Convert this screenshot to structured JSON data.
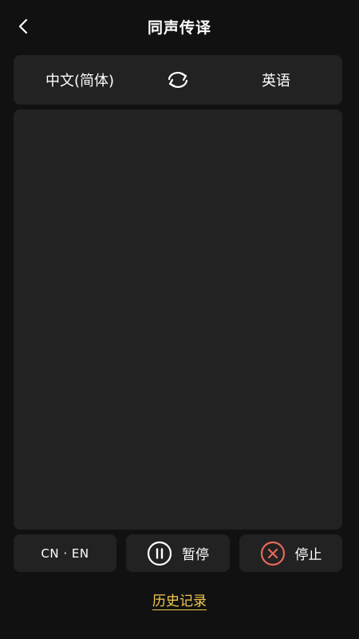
{
  "header": {
    "title": "同声传译"
  },
  "languages": {
    "source": "中文(简体)",
    "target": "英语"
  },
  "controls": {
    "lang_pair": "CN · EN",
    "pause_label": "暂停",
    "stop_label": "停止"
  },
  "footer": {
    "history_label": "历史记录"
  },
  "colors": {
    "background": "#111111",
    "panel": "#222222",
    "stop_accent": "#e8675a",
    "link": "#f3c94f"
  },
  "icons": {
    "back": "chevron-left-icon",
    "swap": "swap-arrows-icon",
    "pause": "pause-circle-icon",
    "stop": "close-circle-icon"
  }
}
